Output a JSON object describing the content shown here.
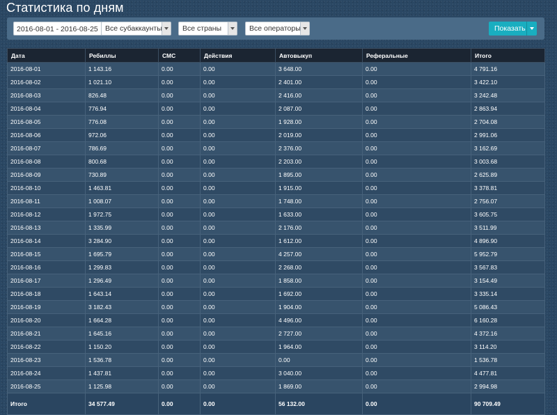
{
  "page": {
    "title": "Статистика по дням"
  },
  "filters": {
    "date_range": "2016-08-01 - 2016-08-25",
    "subaccount": "Все субаккаунты",
    "country": "Все страны",
    "operator": "Все операторы",
    "show_label": "Показать"
  },
  "colors": {
    "accent": "#19aec0",
    "background": "#2a4763",
    "header": "#1b2532"
  },
  "table": {
    "headers": [
      "Дата",
      "Ребиллы",
      "СМС",
      "Действия",
      "Автовыкуп",
      "Реферальные",
      "Итого"
    ],
    "rows": [
      [
        "2016-08-01",
        "1 143.16",
        "0.00",
        "0.00",
        "3 648.00",
        "0.00",
        "4 791.16"
      ],
      [
        "2016-08-02",
        "1 021.10",
        "0.00",
        "0.00",
        "2 401.00",
        "0.00",
        "3 422.10"
      ],
      [
        "2016-08-03",
        "826.48",
        "0.00",
        "0.00",
        "2 416.00",
        "0.00",
        "3 242.48"
      ],
      [
        "2016-08-04",
        "776.94",
        "0.00",
        "0.00",
        "2 087.00",
        "0.00",
        "2 863.94"
      ],
      [
        "2016-08-05",
        "776.08",
        "0.00",
        "0.00",
        "1 928.00",
        "0.00",
        "2 704.08"
      ],
      [
        "2016-08-06",
        "972.06",
        "0.00",
        "0.00",
        "2 019.00",
        "0.00",
        "2 991.06"
      ],
      [
        "2016-08-07",
        "786.69",
        "0.00",
        "0.00",
        "2 376.00",
        "0.00",
        "3 162.69"
      ],
      [
        "2016-08-08",
        "800.68",
        "0.00",
        "0.00",
        "2 203.00",
        "0.00",
        "3 003.68"
      ],
      [
        "2016-08-09",
        "730.89",
        "0.00",
        "0.00",
        "1 895.00",
        "0.00",
        "2 625.89"
      ],
      [
        "2016-08-10",
        "1 463.81",
        "0.00",
        "0.00",
        "1 915.00",
        "0.00",
        "3 378.81"
      ],
      [
        "2016-08-11",
        "1 008.07",
        "0.00",
        "0.00",
        "1 748.00",
        "0.00",
        "2 756.07"
      ],
      [
        "2016-08-12",
        "1 972.75",
        "0.00",
        "0.00",
        "1 633.00",
        "0.00",
        "3 605.75"
      ],
      [
        "2016-08-13",
        "1 335.99",
        "0.00",
        "0.00",
        "2 176.00",
        "0.00",
        "3 511.99"
      ],
      [
        "2016-08-14",
        "3 284.90",
        "0.00",
        "0.00",
        "1 612.00",
        "0.00",
        "4 896.90"
      ],
      [
        "2016-08-15",
        "1 695.79",
        "0.00",
        "0.00",
        "4 257.00",
        "0.00",
        "5 952.79"
      ],
      [
        "2016-08-16",
        "1 299.83",
        "0.00",
        "0.00",
        "2 268.00",
        "0.00",
        "3 567.83"
      ],
      [
        "2016-08-17",
        "1 296.49",
        "0.00",
        "0.00",
        "1 858.00",
        "0.00",
        "3 154.49"
      ],
      [
        "2016-08-18",
        "1 643.14",
        "0.00",
        "0.00",
        "1 692.00",
        "0.00",
        "3 335.14"
      ],
      [
        "2016-08-19",
        "3 182.43",
        "0.00",
        "0.00",
        "1 904.00",
        "0.00",
        "5 086.43"
      ],
      [
        "2016-08-20",
        "1 664.28",
        "0.00",
        "0.00",
        "4 496.00",
        "0.00",
        "6 160.28"
      ],
      [
        "2016-08-21",
        "1 645.16",
        "0.00",
        "0.00",
        "2 727.00",
        "0.00",
        "4 372.16"
      ],
      [
        "2016-08-22",
        "1 150.20",
        "0.00",
        "0.00",
        "1 964.00",
        "0.00",
        "3 114.20"
      ],
      [
        "2016-08-23",
        "1 536.78",
        "0.00",
        "0.00",
        "0.00",
        "0.00",
        "1 536.78"
      ],
      [
        "2016-08-24",
        "1 437.81",
        "0.00",
        "0.00",
        "3 040.00",
        "0.00",
        "4 477.81"
      ],
      [
        "2016-08-25",
        "1 125.98",
        "0.00",
        "0.00",
        "1 869.00",
        "0.00",
        "2 994.98"
      ]
    ],
    "totals": [
      "Итого",
      "34 577.49",
      "0.00",
      "0.00",
      "56 132.00",
      "0.00",
      "90 709.49"
    ]
  }
}
